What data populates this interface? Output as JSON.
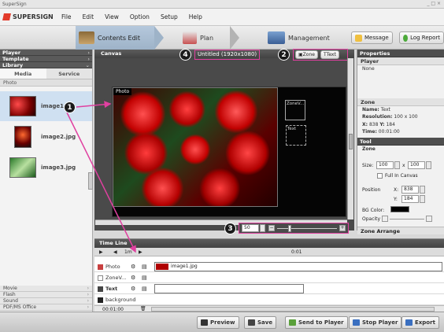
{
  "window": {
    "title": "SuperSign",
    "controls": "_ □ ×"
  },
  "app": {
    "name": "SUPERSIGN"
  },
  "menu": [
    "File",
    "Edit",
    "View",
    "Option",
    "Setup",
    "Help"
  ],
  "nav_tabs": [
    {
      "label": "Contents Edit",
      "active": true
    },
    {
      "label": "Plan",
      "active": false
    },
    {
      "label": "Management",
      "active": false
    }
  ],
  "top_buttons": {
    "message": "Message",
    "log_report": "Log Report"
  },
  "left_panel": {
    "sections": {
      "player": "Player",
      "template": "Template",
      "library": "Library"
    },
    "subtabs": [
      "Media",
      "Service"
    ],
    "category": "Photo",
    "items": [
      {
        "label": "image1",
        "selected": true
      },
      {
        "label": "image2.jpg",
        "selected": false
      },
      {
        "label": "image3.jpg",
        "selected": false
      }
    ],
    "lower_categories": [
      "Movie",
      "Flash",
      "Sound",
      "PDF/MS Office"
    ]
  },
  "canvas": {
    "panel_title": "Canvas",
    "doc_title": "Untitled (1920x1080)",
    "zone_button": "Zone",
    "text_button": "Text",
    "photo_label": "Photo",
    "zone_label": "ZoneV...",
    "text_label": "Text",
    "zoom_value": "50"
  },
  "properties": {
    "panel_title": "Properties",
    "player_section": "Player",
    "player_value": "None",
    "zone_section": "Zone",
    "name_label": "Name:",
    "name_value": "Text",
    "resolution_label": "Resolution:",
    "resolution_value": "100 x 100",
    "xy_label": "X:",
    "x_value": "838",
    "y_label": "Y:",
    "y_value": "184",
    "time_label": "Time:",
    "time_value": "00:01:00",
    "tool_section": "Tool",
    "tool_zone": "Zone",
    "size_label": "Size:",
    "size_w": "100",
    "size_x": "x",
    "size_h": "100",
    "full_canvas": "Full In Canvas",
    "position_label": "Position",
    "pos_x_label": "X:",
    "pos_x": "838",
    "pos_y_label": "Y:",
    "pos_y": "184",
    "bg_color_label": "BG Color:",
    "opacity_label": "Opacity",
    "zone_arrange": "Zone Arrange"
  },
  "timeline": {
    "title": "Time Line",
    "time_marker": "0:01",
    "scale_label": "1m",
    "tracks": [
      {
        "name": "Photo",
        "clip": "image1.jpg"
      },
      {
        "name": "ZoneV...",
        "clip": ""
      },
      {
        "name": "Text",
        "clip": ""
      },
      {
        "name": "background",
        "clip": ""
      }
    ],
    "duration": "00:01:00"
  },
  "bottom_buttons": [
    "Preview",
    "Save",
    "Send to Player",
    "Stop Player",
    "Export"
  ],
  "callouts": [
    "1",
    "2",
    "3",
    "4"
  ],
  "colors": {
    "accent_pink": "#e040a0",
    "active_tab": "#9eb3c8",
    "panel_dark": "#4a4a4a"
  }
}
